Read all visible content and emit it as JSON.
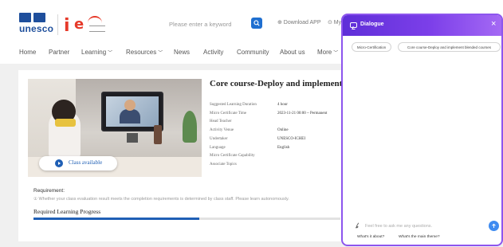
{
  "header": {
    "unesco_text": "unesco",
    "search_placeholder": "Please enter a keyword",
    "download_app": "⊕ Download APP",
    "my_link": "⊙ My"
  },
  "nav": {
    "items": [
      {
        "label": "Home"
      },
      {
        "label": "Partner"
      },
      {
        "label": "Learning",
        "dropdown": true
      },
      {
        "label": "Resources",
        "dropdown": true
      },
      {
        "label": "News"
      },
      {
        "label": "Activity"
      },
      {
        "label": "Community"
      },
      {
        "label": "About us"
      },
      {
        "label": "More",
        "dropdown": true
      }
    ]
  },
  "course": {
    "title": "Core course-Deploy and implement bl",
    "class_status": "Class available",
    "info": [
      {
        "key": "Suggested Learning Duration",
        "value": "4 hour"
      },
      {
        "key": "Micro Certificate Time",
        "value": "2023-11-21 00:00 ~ Permanent"
      },
      {
        "key": "Head Teacher",
        "value": ""
      },
      {
        "key": "Activity Venue",
        "value": "Online"
      },
      {
        "key": "Undertaker",
        "value": "UNESCO-ICHEI"
      },
      {
        "key": "Language",
        "value": "English"
      },
      {
        "key": "Micro Certificate Capability",
        "value": ""
      },
      {
        "key": "Associate Topics",
        "value": ""
      }
    ],
    "requirement_label": "Requirement:",
    "requirement_text": "① Whether your class evaluation result meets the completion requirements is determined by class staff. Please learn autonomously.",
    "progress_title": "Required Learning Progress",
    "progress_fraction": 0.54
  },
  "dialog": {
    "title": "Dialogue",
    "close": "×",
    "chips": [
      "Micro-Certification",
      "Core course-Deploy and implement blended courses"
    ],
    "input_placeholder": "Feel free to ask me any questions.",
    "suggestions": [
      "What's it about?",
      "What's the main theme?"
    ]
  },
  "colors": {
    "accent": "#1f5fb5",
    "dialog_gradient_start": "#5f2fd8",
    "dialog_gradient_end": "#a469f4",
    "brand_red": "#e63a2a",
    "send_button": "#3f8bf0"
  }
}
